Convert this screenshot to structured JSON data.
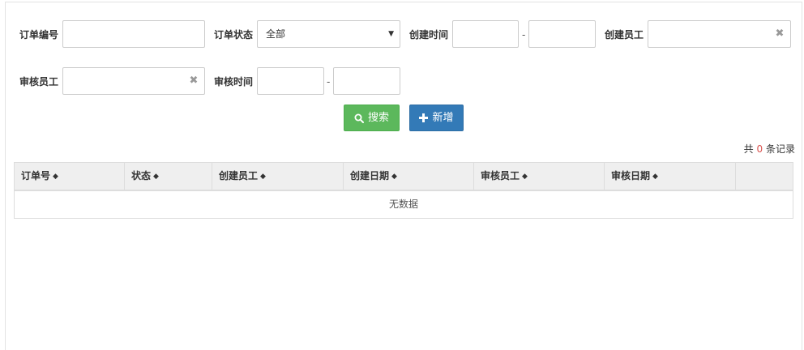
{
  "filters": {
    "order_no_label": "订单编号",
    "order_status_label": "订单状态",
    "order_status_value": "全部",
    "create_time_label": "创建时间",
    "create_staff_label": "创建员工",
    "audit_staff_label": "审核员工",
    "audit_time_label": "审核时间",
    "range_separator": "-",
    "clear_symbol": "✖"
  },
  "actions": {
    "search_label": "搜索",
    "add_label": "新增",
    "search_color": "#5cb85c",
    "add_color": "#337ab7"
  },
  "records": {
    "prefix": "共",
    "count": "0",
    "suffix": "条记录"
  },
  "table": {
    "columns": [
      {
        "label": "订单号"
      },
      {
        "label": "状态"
      },
      {
        "label": "创建员工"
      },
      {
        "label": "创建日期"
      },
      {
        "label": "审核员工"
      },
      {
        "label": "审核日期"
      },
      {
        "label": ""
      }
    ],
    "sort_symbol": "◆",
    "empty_text": "无数据"
  },
  "icons": {
    "search": "search-icon",
    "add": "plus-icon",
    "clear": "close-icon",
    "caret": "caret-down-icon",
    "sort": "sort-icon"
  }
}
